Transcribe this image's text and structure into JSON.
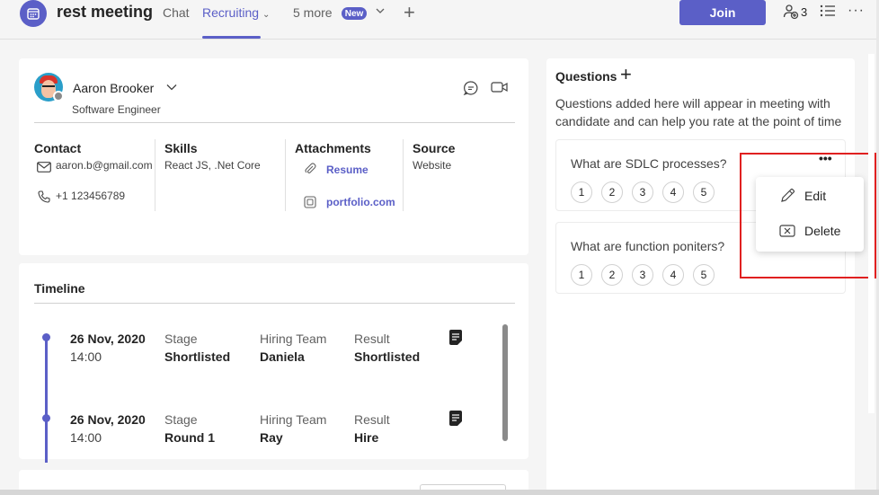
{
  "header": {
    "meeting_title": "rest meeting",
    "tabs": [
      {
        "label": "Chat"
      },
      {
        "label": "Recruiting",
        "chevron": "⌄"
      },
      {
        "label": "5 more"
      }
    ],
    "new_badge": "New",
    "join_label": "Join",
    "participant_count": "3"
  },
  "candidate": {
    "name": "Aaron Brooker",
    "role": "Software Engineer",
    "contact_heading": "Contact",
    "email": "aaron.b@gmail.com",
    "phone": "+1 123456789",
    "skills_heading": "Skills",
    "skills": "React JS, .Net Core",
    "attachments_heading": "Attachments",
    "attachments": [
      "Resume",
      "portfolio.com"
    ],
    "source_heading": "Source",
    "source": "Website"
  },
  "timeline": {
    "title": "Timeline",
    "labels": {
      "stage": "Stage",
      "team": "Hiring Team",
      "result": "Result"
    },
    "entries": [
      {
        "date": "26 Nov, 2020",
        "time": "14:00",
        "stage": "Shortlisted",
        "team": "Daniela",
        "result": "Shortlisted"
      },
      {
        "date": "26 Nov, 2020",
        "time": "14:00",
        "stage": "Round 1",
        "team": "Ray",
        "result": "Hire"
      }
    ]
  },
  "questions": {
    "title": "Questions",
    "description": "Questions added here will appear in meeting with candidate and can help you rate at the point of time",
    "items": [
      {
        "text": "What are SDLC processes?"
      },
      {
        "text": "What are function poniters?"
      }
    ],
    "ratings": [
      "1",
      "2",
      "3",
      "4",
      "5"
    ]
  },
  "context_menu": {
    "edit_label": "Edit",
    "delete_label": "Delete"
  },
  "colors": {
    "brand": "#5b5fc7",
    "highlight": "#e02020"
  }
}
